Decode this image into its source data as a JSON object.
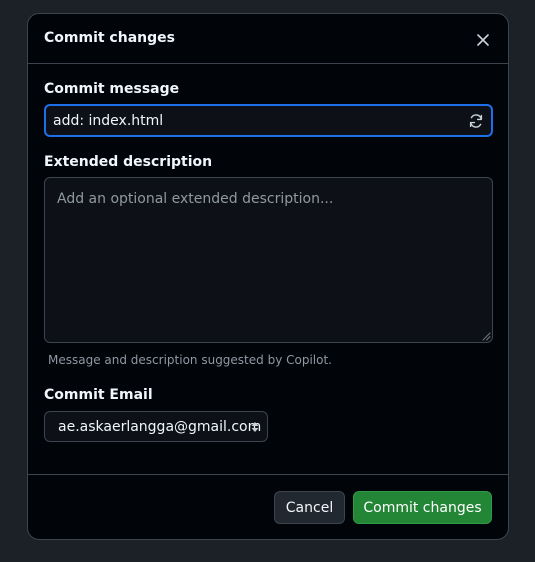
{
  "dialog": {
    "title": "Commit changes",
    "close_icon": "close-icon"
  },
  "commit_message": {
    "label": "Commit message",
    "value": "add: index.html",
    "refresh_icon": "refresh-icon"
  },
  "extended_description": {
    "label": "Extended description",
    "placeholder": "Add an optional extended description...",
    "value": ""
  },
  "hint": "Message and description suggested by Copilot.",
  "commit_email": {
    "label": "Commit Email",
    "selected": "ae.askaerlangga@gmail.com"
  },
  "footer": {
    "cancel_label": "Cancel",
    "commit_label": "Commit changes"
  },
  "colors": {
    "background": "#010409",
    "accent_focus": "#1f6feb",
    "primary_button": "#238636",
    "border": "#3d444d"
  }
}
